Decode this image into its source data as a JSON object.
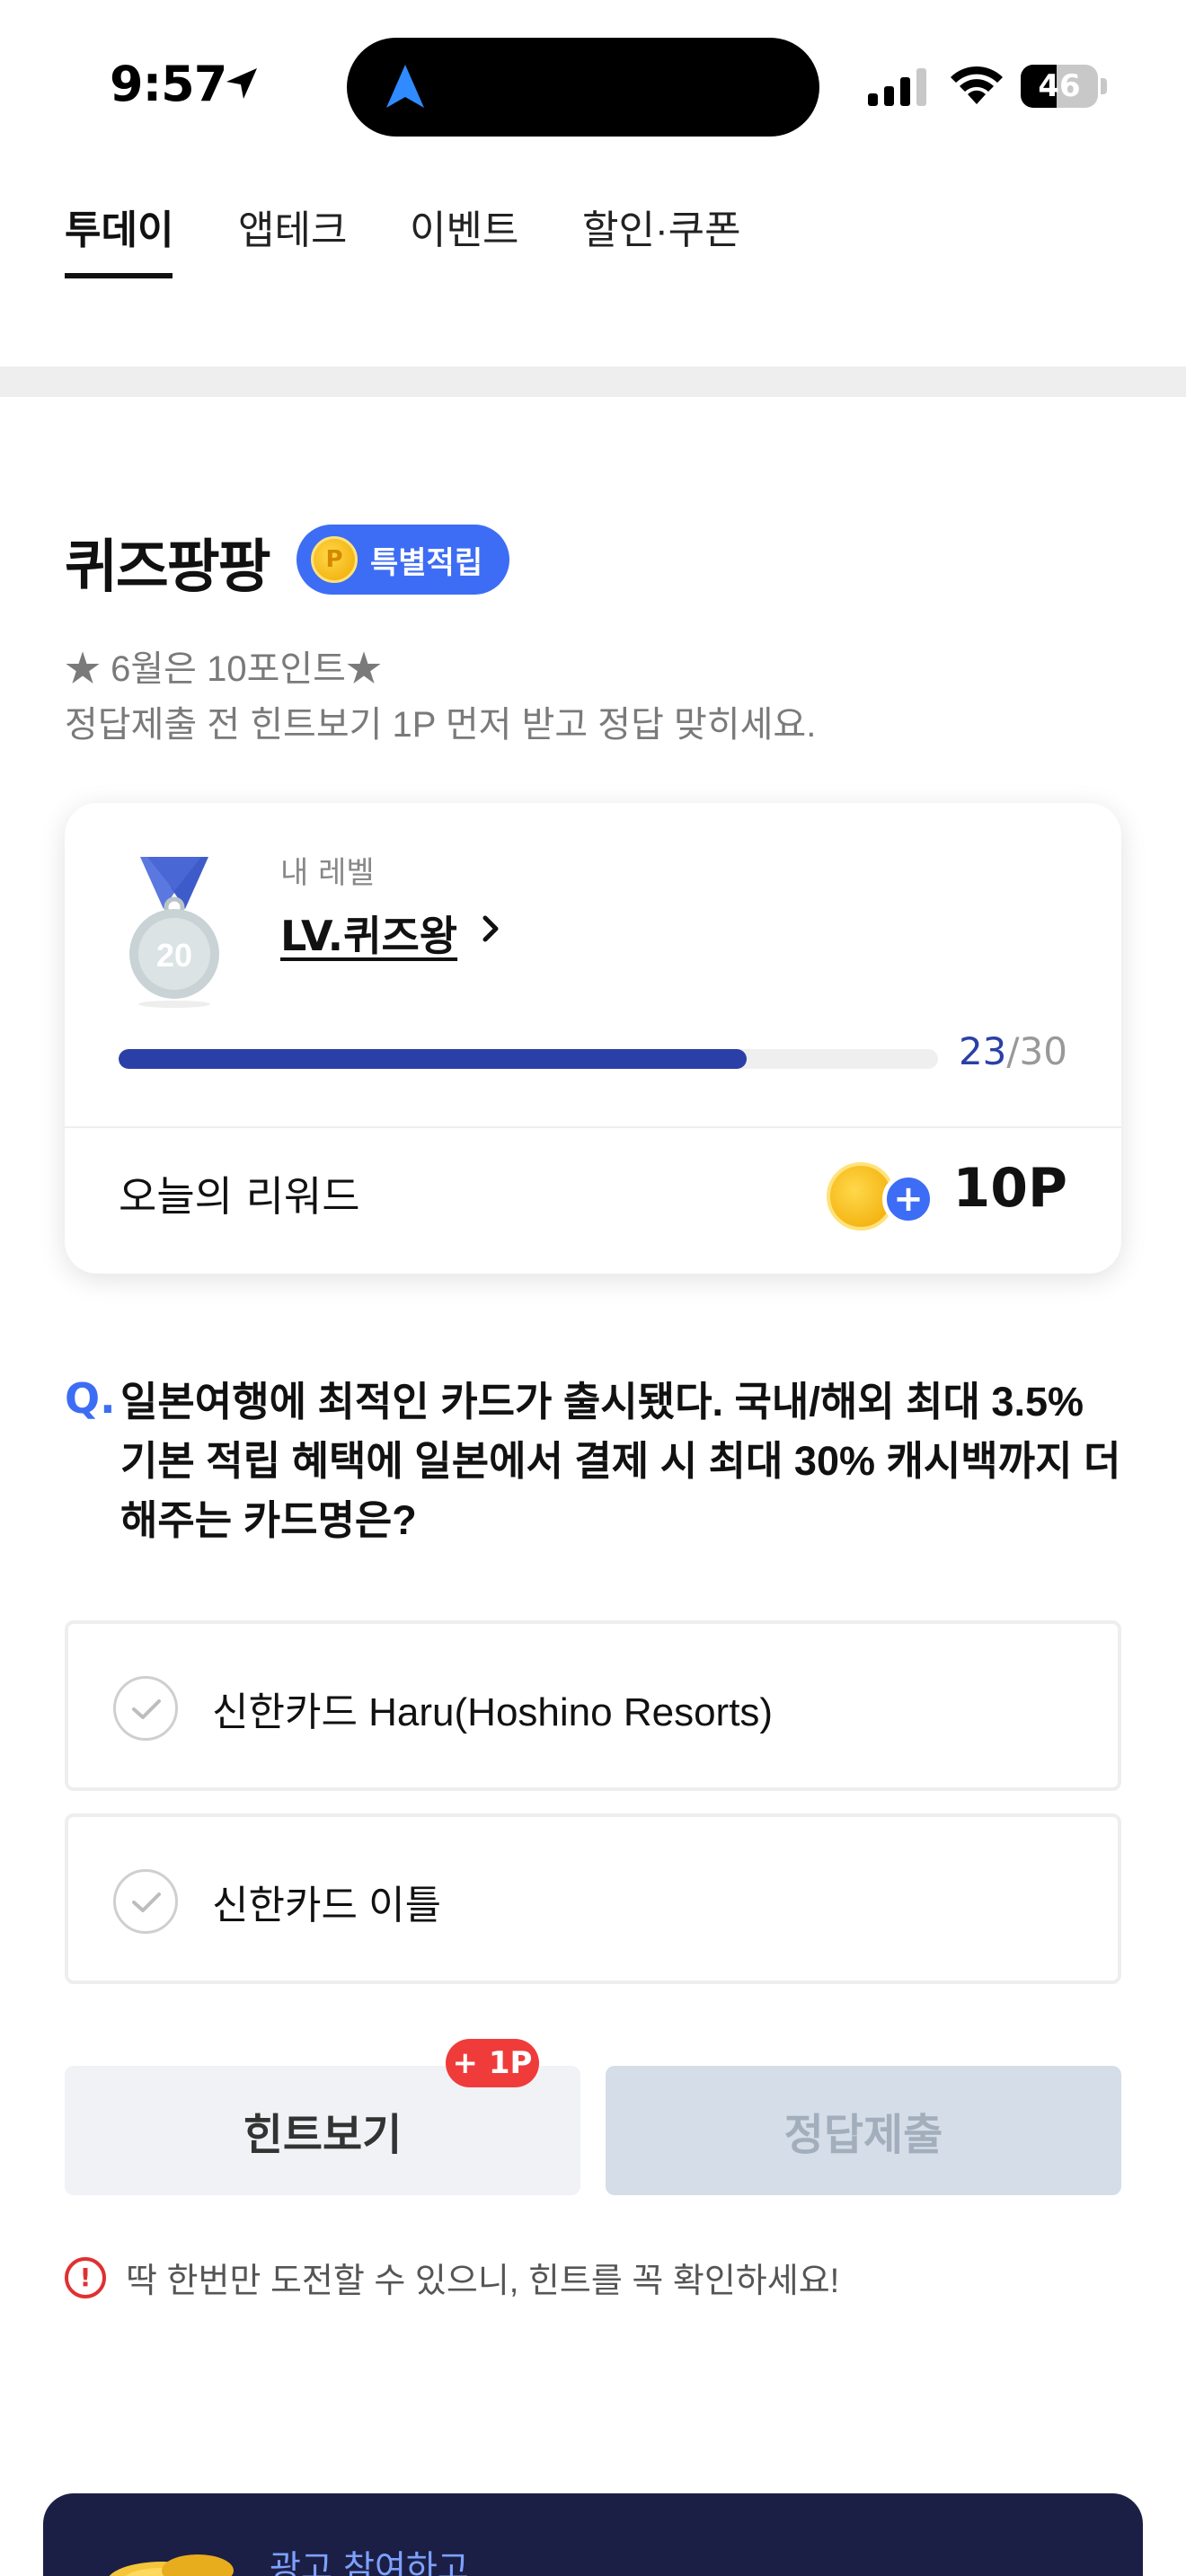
{
  "status_bar": {
    "time": "9:57",
    "battery": "46",
    "battery_level": 0.46
  },
  "tabs": [
    {
      "label": "투데이",
      "active": true
    },
    {
      "label": "앱테크",
      "active": false
    },
    {
      "label": "이벤트",
      "active": false
    },
    {
      "label": "할인·쿠폰",
      "active": false
    }
  ],
  "quiz": {
    "title": "퀴즈팡팡",
    "badge": "특별적립",
    "coin_letter": "P",
    "desc_line1": "★ 6월은 10포인트★",
    "desc_line2": "정답제출 전 힌트보기 1P 먼저 받고 정답 맞히세요."
  },
  "level_card": {
    "label": "내 레벨",
    "level_name": "LV.퀴즈왕",
    "medal_number": "20",
    "progress_current": "23",
    "progress_total": "/30",
    "progress_fraction": 0.7667,
    "reward_label": "오늘의 리워드",
    "reward_value": "10P"
  },
  "question": {
    "marker": "Q.",
    "text": "일본여행에 최적인 카드가 출시됐다. 국내/해외 최대 3.5% 기본 적립 혜택에 일본에서 결제 시 최대 30% 캐시백까지 더해주는 카드명은?",
    "options": [
      "신한카드 Haru(Hoshino Resorts)",
      "신한카드 이틀"
    ]
  },
  "buttons": {
    "hint": "힌트보기",
    "hint_badge": "+ 1P",
    "submit": "정답제출"
  },
  "notice": {
    "icon": "!",
    "text": "딱 한번만 도전할 수 있으니, 힌트를 꼭 확인하세요!"
  },
  "ad": {
    "text": "광고 참여하고"
  },
  "colors": {
    "accent": "#3d6df5",
    "progress": "#2b40a6",
    "badge_red": "#f03b3b",
    "ad_bg": "#1c1f45"
  }
}
